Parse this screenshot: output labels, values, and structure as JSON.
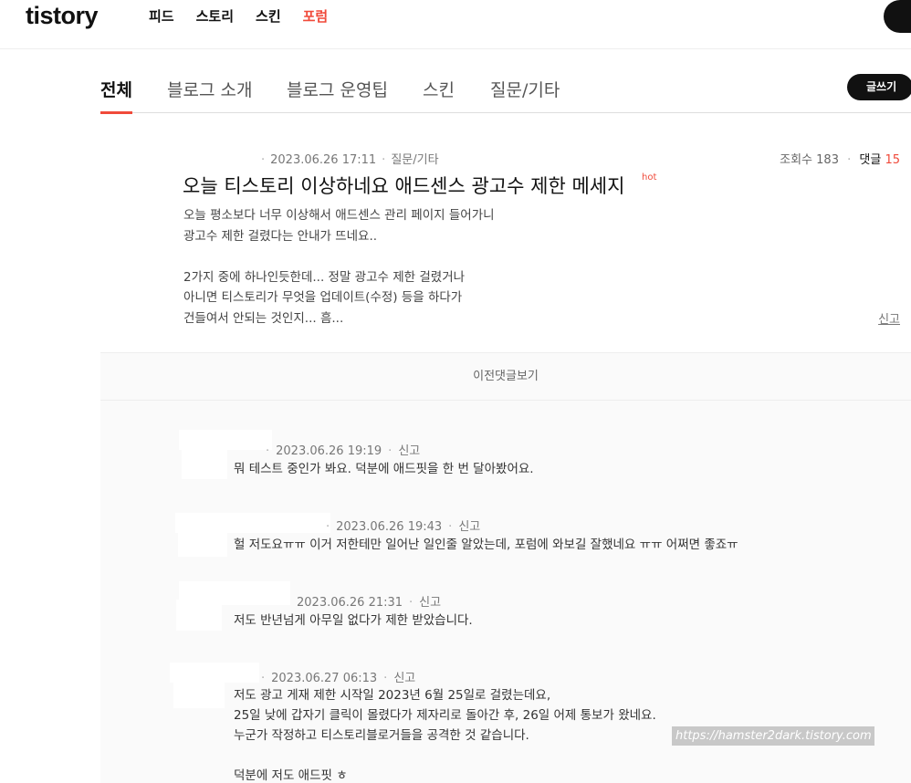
{
  "header": {
    "logo": "tistory",
    "nav": [
      {
        "label": "피드"
      },
      {
        "label": "스토리"
      },
      {
        "label": "스킨"
      },
      {
        "label": "포럼"
      }
    ]
  },
  "categories": {
    "tabs": [
      {
        "label": "전체"
      },
      {
        "label": "블로그 소개"
      },
      {
        "label": "블로그 운영팁"
      },
      {
        "label": "스킨"
      },
      {
        "label": "질문/기타"
      }
    ],
    "write_label": "글쓰기"
  },
  "post": {
    "date": "2023.06.26 17:11",
    "category": "질문/기타",
    "views_label": "조회수 183",
    "comments_label": "댓글",
    "comments_count": "15",
    "title": "오늘 티스토리 이상하네요 애드센스 광고수 제한 메세지",
    "hot_badge": "hot",
    "body": [
      "오늘 평소보다 너무 이상해서 애드센스 관리 페이지 들어가니",
      "광고수 제한 걸렸다는 안내가 뜨네요..",
      "",
      "2가지 중에 하나인듯한데... 정말 광고수 제한 걸렸거나",
      "아니면 티스토리가 무엇을 업데이트(수정) 등을 하다가",
      "건들여서 안되는 것인지... 흠..."
    ],
    "report_label": "신고"
  },
  "comments_section": {
    "prev_label": "이전댓글보기",
    "comments": [
      {
        "date": "2023.06.26 19:19",
        "report": "신고",
        "lines": [
          "뭐 테스트 중인가 봐요. 덕분에 애드핏을 한 번 달아봤어요."
        ]
      },
      {
        "date": "2023.06.26 19:43",
        "report": "신고",
        "lines": [
          "헐 저도요ㅠㅠ 이거 저한테만 일어난 일인줄 알았는데, 포럼에 와보길 잘했네요 ㅠㅠ 어쩌면 좋죠ㅠ"
        ]
      },
      {
        "date": "2023.06.26 21:31",
        "report": "신고",
        "lines": [
          "저도 반년넘게 아무일 없다가 제한 받았습니다."
        ]
      },
      {
        "date": "2023.06.27 06:13",
        "report": "신고",
        "lines": [
          "저도 광고 게재 제한 시작일 2023년 6월 25일로 걸렸는데요,",
          "25일 낮에 갑자기 클릭이 몰렸다가 제자리로 돌아간 후, 26일 어제 통보가 왔네요.",
          "누군가 작정하고 티스토리블로거들을 공격한 것 같습니다.",
          "",
          "덕분에 저도 애드핏 ㅎ"
        ]
      }
    ]
  },
  "watermark": "https://hamster2dark.tistory.com"
}
